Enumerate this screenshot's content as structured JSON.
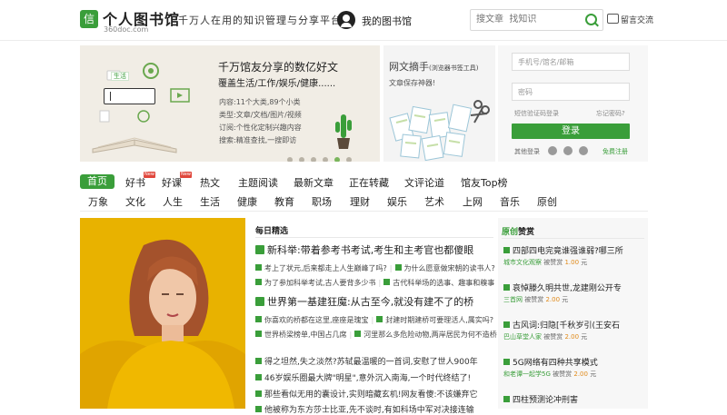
{
  "header": {
    "logo_glyph": "信",
    "logo_title": "个人图书馆",
    "logo_domain": "360doc.com",
    "slogan": "千万人在用的知识管理与分享平台",
    "my_library": "我的图书馆",
    "search_placeholder": "搜文章  找知识",
    "message_label": "留言交流"
  },
  "banner": {
    "title": "千万馆友分享的数亿好文",
    "subtitle": "覆盖生活/工作/娱乐/健康......",
    "info": [
      "内容:11个大类,89个小类",
      "类型:文章/文档/图片/视频",
      "订阅:个性化定制兴趣内容",
      "搜索:精准查找,一搜即访"
    ],
    "tag": "生活",
    "dots": 6,
    "active_dot": 5
  },
  "banner2": {
    "title": "网文摘手",
    "title_note": "(浏览器书签工具)",
    "subtitle": "文章保存神器!"
  },
  "login": {
    "account_placeholder": "手机号/馆名/邮箱",
    "password_placeholder": "密码",
    "sms_login": "短信验证码登录",
    "forgot": "忘记密码?",
    "button": "登录",
    "other": "其他登录",
    "register": "免费注册"
  },
  "nav": {
    "row1": [
      {
        "label": "首页",
        "active": true
      },
      {
        "label": "好书",
        "badge": "New"
      },
      {
        "label": "好课",
        "badge": "New"
      },
      {
        "label": "热文"
      },
      {
        "label": "主题阅读"
      },
      {
        "label": "最新文章"
      },
      {
        "label": "正在转藏"
      },
      {
        "label": "文评论道"
      },
      {
        "label": "馆友Top榜"
      }
    ],
    "row2": [
      "万象",
      "文化",
      "人生",
      "生活",
      "健康",
      "教育",
      "职场",
      "理财",
      "娱乐",
      "艺术",
      "上网",
      "音乐",
      "原创"
    ]
  },
  "daily": {
    "label": "每日精选",
    "headline1": "新科举:带着参考书考试,考生和主考官也都傻眼",
    "sub1a": "考上了状元,后来都走上人生巅峰了吗?",
    "sub1b": "为什么愿意做宋朝的读书人?",
    "sub1c": "为了参加科举考试,古人要背多少书",
    "sub1d": "古代科举场的选事、趣事和糗事",
    "headline2": "世界第一基建狂魔:从古至今,就没有建不了的桥",
    "sub2a": "你喜欢的桥都在这里,座座是瑰宝",
    "sub2b": "封建时期建桥可要理活人,属实吗?",
    "sub2c": "世界桥梁榜单,中国占几席",
    "sub2d": "河里那么多危险动物,两岸居民为何不造桥",
    "list": [
      "得之坦然,失之淡然?苏轼最温暖的一首词,安慰了世人900年",
      "46岁娱乐圈最大牌\"明星\",意外沉入南海,一个时代终结了!",
      "那些看似无用的囊设计,实则暗藏玄机!网友看傻:不该嫌弃它",
      "他被称为东方莎士比亚,先不谈时,有如科场中军对决接连输"
    ]
  },
  "original": {
    "label_a": "原创",
    "label_b": "赞赏",
    "items": [
      {
        "title": "四部四电完竟谁强谁弱?哪三所",
        "source": "城市文化观察",
        "meta": "被赞赏",
        "price": "1.00",
        "unit": "元"
      },
      {
        "title": "哀悼滕久明共世,龙建刚公开专",
        "source": "三首网",
        "meta": "被赞赏",
        "price": "2.00",
        "unit": "元"
      },
      {
        "title": "古风词:归隐[千秋岁引(王安石",
        "source": "巴山草堂人家",
        "meta": "被赞赏",
        "price": "2.00",
        "unit": "元"
      },
      {
        "title": "5G网络有四种共享模式",
        "source": "和老谭一起学5G",
        "meta": "被赞赏",
        "price": "2.00",
        "unit": "元"
      },
      {
        "title": "四柱预测论冲刑害",
        "source": "",
        "meta": "",
        "price": "",
        "unit": ""
      }
    ]
  },
  "colors": {
    "brand": "#3a9e3a",
    "badge": "#e0473c",
    "price": "#e08a1a"
  }
}
